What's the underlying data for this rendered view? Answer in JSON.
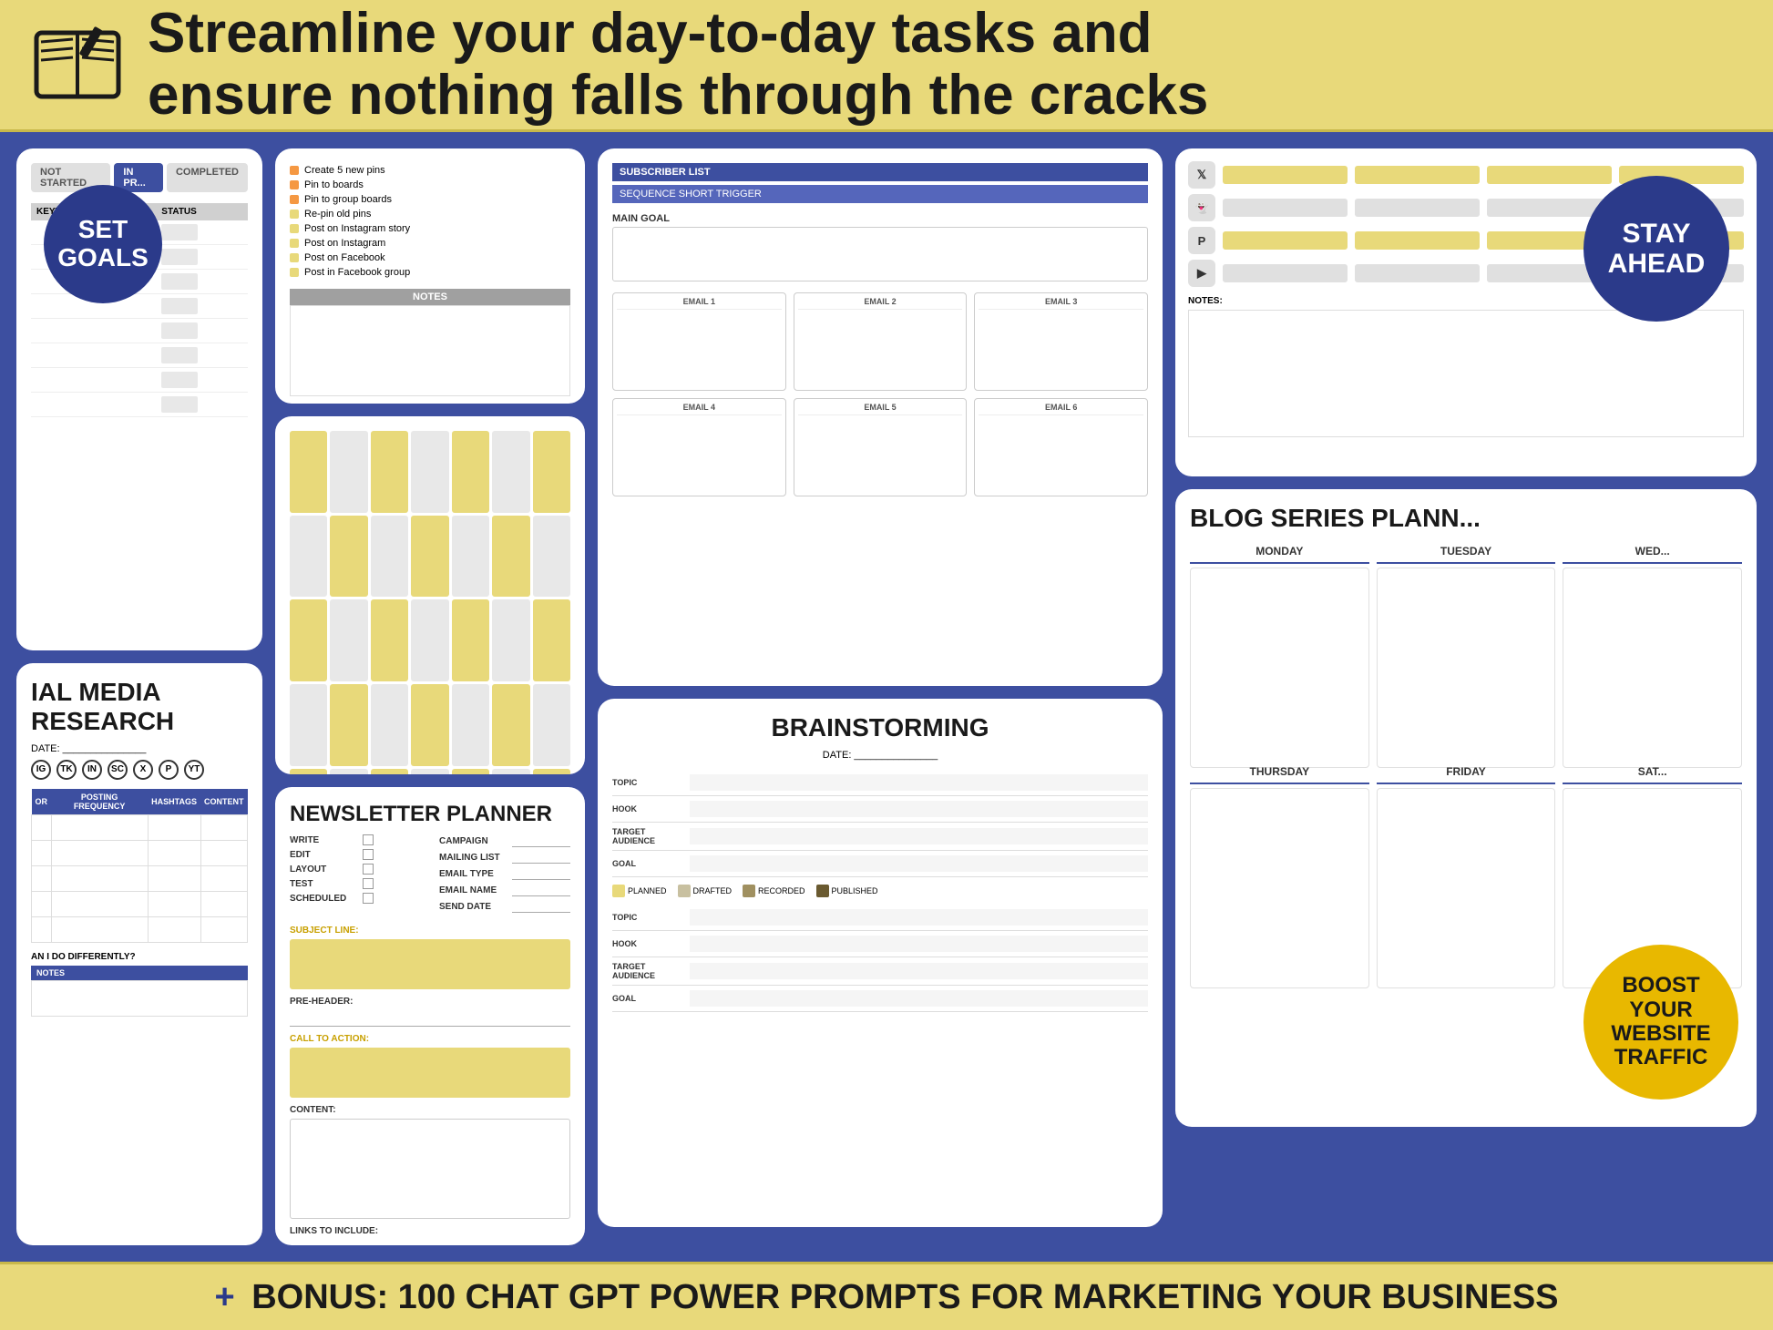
{
  "header": {
    "title_line1": "Streamline your day-to-day tasks and",
    "title_line2": "ensure nothing falls through the cracks"
  },
  "footer": {
    "plus": "+",
    "text": "BONUS: 100 CHAT GPT POWER PROMPTS FOR MARKETING YOUR BUSINESS"
  },
  "badges": {
    "set_goals": "SET GOALS",
    "stay_ahead_line1": "STAY",
    "stay_ahead_line2": "AHEAD",
    "boost_line1": "BOOST",
    "boost_line2": "YOUR",
    "boost_line3": "WEBSITE",
    "boost_line4": "TRAFFIC"
  },
  "goals_panel": {
    "status_tabs": [
      "NOT STARTED",
      "IN PR...",
      "COMPLETED"
    ],
    "columns": [
      "KEYWORDS",
      "STATUS"
    ]
  },
  "checklist_panel": {
    "items": [
      "Create 5 new pins",
      "Pin to boards",
      "Pin to group boards",
      "Re-pin old pins",
      "Post on Instagram story",
      "Post on Instagram",
      "Post on Facebook",
      "Post in Facebook group"
    ],
    "notes_label": "NOTES"
  },
  "email_sequence": {
    "subscriber_list": "SUBSCRIBER LIST",
    "sequence_label": "SEQUENCE SHORT TRIGGER",
    "main_goal_label": "MAIN GOAL",
    "emails": [
      "EMAIL 1",
      "EMAIL 2",
      "EMAIL 3",
      "EMAIL 4",
      "EMAIL 5",
      "EMAIL 6"
    ]
  },
  "newsletter_planner": {
    "title": "NEWSLETTER PLANNER",
    "form_rows_left": [
      "WRITE",
      "EDIT",
      "LAYOUT",
      "TEST",
      "SCHEDULED"
    ],
    "form_rows_right": [
      "CAMPAIGN",
      "MAILING LIST",
      "EMAIL TYPE",
      "EMAIL NAME",
      "SEND DATE"
    ],
    "subject_line": "SUBJECT LINE:",
    "pre_header": "PRE-HEADER:",
    "call_to_action": "CALL TO ACTION:",
    "content": "CONTENT:",
    "links": "LINKS TO INCLUDE:"
  },
  "brainstorming": {
    "title": "BRAINSTORMING",
    "date_label": "DATE:",
    "rows1": [
      "TOPIC",
      "HOOK",
      "TARGET AUDIENCE",
      "GOAL"
    ],
    "legend": [
      "PLANNED",
      "DRAFTED",
      "RECORDED",
      "PUBLISHED"
    ],
    "legend_colors": [
      "#e8d97a",
      "#c8c0a0",
      "#a09060",
      "#6a5a30"
    ],
    "rows2": [
      "TOPIC",
      "HOOK",
      "TARGET AUDIENCE",
      "GOAL"
    ]
  },
  "social_research": {
    "title": "IAL MEDIA RESEARCH",
    "date_label": "DATE:",
    "columns": [
      "OR",
      "POSTING FREQUENCY",
      "HASHTAGS",
      "CONTENT"
    ],
    "what_differently": "AN I DO DIFFERENTLY?",
    "notes_label": "NOTES"
  },
  "blog_series": {
    "title": "BLOG SERIES PLANN...",
    "days": [
      "MONDAY",
      "TUESDAY",
      "WED...",
      "THURSDAY",
      "FRIDAY",
      "SAT..."
    ]
  },
  "social_top_right": {
    "icons": [
      "𝕏",
      "👻",
      "𝙋",
      "▶"
    ]
  },
  "notes_right": {
    "label": "NOTES:"
  }
}
